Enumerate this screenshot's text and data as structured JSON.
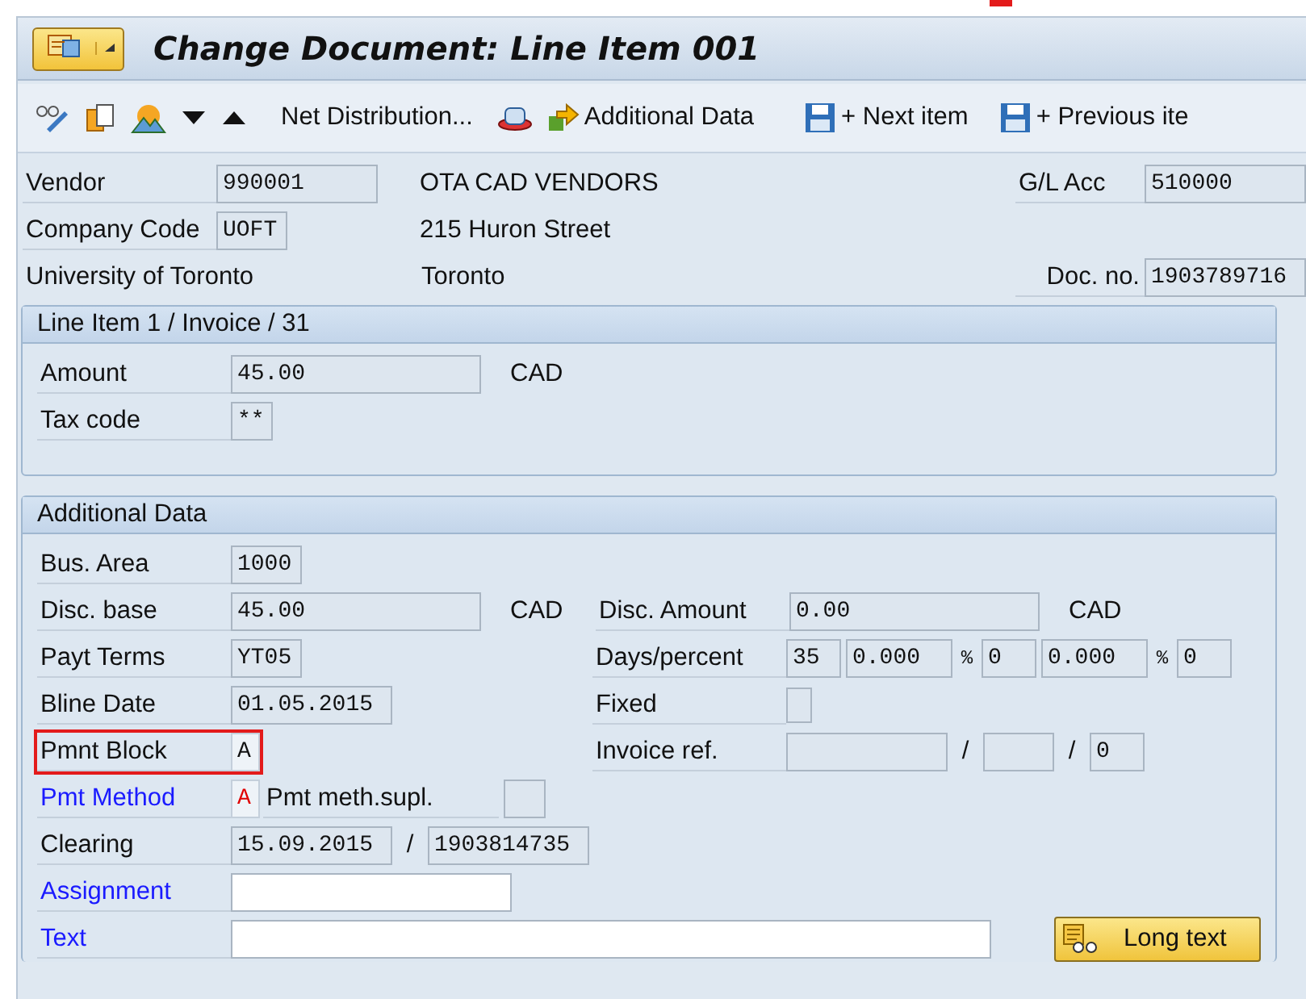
{
  "window": {
    "title": "Change Document: Line Item 001"
  },
  "toolbar": {
    "net_distribution": "Net Distribution...",
    "additional_data": "Additional Data",
    "next_item": "+ Next item",
    "previous_item": "+ Previous ite"
  },
  "header": {
    "vendor": {
      "label": "Vendor",
      "value": "990001",
      "name": "OTA CAD VENDORS"
    },
    "gl_acc": {
      "label": "G/L Acc",
      "value": "510000"
    },
    "company_code": {
      "label": "Company Code",
      "value": "UOFT",
      "street": "215 Huron Street"
    },
    "company_name": "University of Toronto",
    "city": "Toronto",
    "doc_no": {
      "label": "Doc. no.",
      "value": "1903789716"
    }
  },
  "line_item": {
    "title": "Line Item 1 / Invoice / 31",
    "amount": {
      "label": "Amount",
      "value": "45.00",
      "currency": "CAD"
    },
    "tax_code": {
      "label": "Tax code",
      "value": "**"
    }
  },
  "additional": {
    "title": "Additional Data",
    "bus_area": {
      "label": "Bus. Area",
      "value": "1000",
      "link": false
    },
    "disc_base": {
      "label": "Disc. base",
      "value": "45.00",
      "currency": "CAD",
      "link": false
    },
    "disc_amount": {
      "label": "Disc. Amount",
      "value": "0.00",
      "currency": "CAD"
    },
    "payt_terms": {
      "label": "Payt Terms",
      "value": "YT05",
      "link": false
    },
    "days_percent": {
      "label": "Days/percent",
      "days1": "35",
      "pct1": "0.000",
      "pct_sign1": "%",
      "days2": "0",
      "pct2": "0.000",
      "pct_sign2": "%",
      "days3": "0"
    },
    "bline_date": {
      "label": "Bline Date",
      "value": "01.05.2015",
      "link": false
    },
    "fixed": {
      "label": "Fixed",
      "checked": false
    },
    "pmnt_block": {
      "label": "Pmnt Block",
      "value": "A",
      "link": false,
      "highlighted": true
    },
    "invoice_ref": {
      "label": "Invoice ref.",
      "sep1": "/",
      "sep2": "/",
      "part3": "0"
    },
    "pmt_method": {
      "label": "Pmt Method",
      "value": "A",
      "link": true,
      "flagged": true,
      "supl_label": "Pmt meth.supl."
    },
    "clearing": {
      "label": "Clearing",
      "date": "15.09.2015",
      "sep": "/",
      "doc": "1903814735",
      "link": false
    },
    "assignment": {
      "label": "Assignment",
      "link": true,
      "editable": true
    },
    "text": {
      "label": "Text",
      "link": true,
      "editable": true
    },
    "long_text_button": "Long text"
  }
}
